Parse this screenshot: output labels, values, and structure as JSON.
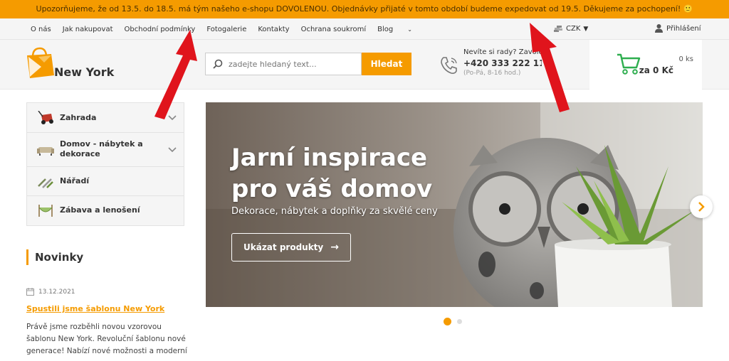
{
  "notice": "Upozorňujeme, že od 13.5. do 18.5. má tým našeho e-shopu DOVOLENOU. Objednávky přijaté v tomto období budeme expedovat od 19.5. Děkujeme za pochopení! 🙂",
  "topnav": {
    "links": [
      "O nás",
      "Jak nakupovat",
      "Obchodní podmínky",
      "Fotogalerie",
      "Kontakty",
      "Ochrana soukromí",
      "Blog"
    ],
    "currency": "CZK",
    "login": "Přihlášení"
  },
  "header": {
    "logo_text": "New York",
    "search_placeholder": "zadejte hledaný text...",
    "search_button": "Hledat",
    "contact_question": "Nevíte si rady? Zavolejte nám",
    "contact_phone": "+420 333 222 111",
    "contact_hours": "(Po-Pá, 8-16 hod.)",
    "cart_qty": "0 ks",
    "cart_price": "za 0 Kč"
  },
  "categories": [
    {
      "label": "Zahrada",
      "icon": "lawn-mower-icon",
      "expandable": true
    },
    {
      "label": "Domov - nábytek a dekorace",
      "icon": "sofa-icon",
      "expandable": true
    },
    {
      "label": "Nářadí",
      "icon": "tools-icon",
      "expandable": false
    },
    {
      "label": "Zábava a lenošení",
      "icon": "hammock-icon",
      "expandable": false
    }
  ],
  "news": {
    "title": "Novinky",
    "date": "13.12.2021",
    "headline": "Spustili jsme šablonu New York",
    "text": "Právě jsme rozběhli novou vzorovou šablonu New York. Revoluční šablonu nové generace! Nabízí nové možnosti a moderní"
  },
  "banner": {
    "title_line1": "Jarní inspirace",
    "title_line2": "pro váš domov",
    "subtitle": "Dekorace, nábytek a doplňky za skvělé ceny",
    "button": "Ukázat produkty"
  },
  "slider": {
    "active": 1,
    "total": 2
  },
  "colors": {
    "accent": "#f59b00",
    "cart_green": "#2eae4f",
    "annotation_red": "#e0141c"
  }
}
